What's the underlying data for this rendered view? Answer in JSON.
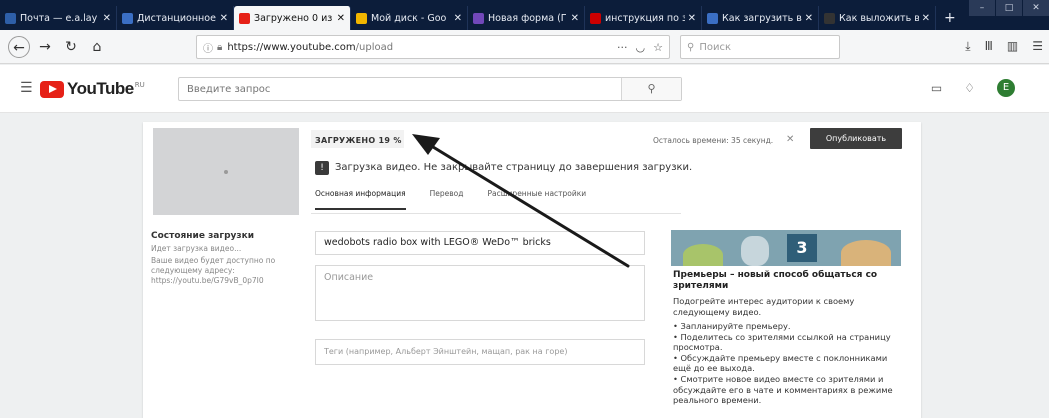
{
  "browser": {
    "tabs": [
      {
        "label": "Почта — e.a.lay",
        "icon": "mail-icon",
        "color": "#2e5fa8"
      },
      {
        "label": "Дистанционное",
        "icon": "page-icon",
        "color": "#3b6fc4"
      },
      {
        "label": "Загружено 0 из",
        "icon": "youtube-icon",
        "color": "#e62117",
        "active": true
      },
      {
        "label": "Мой диск - Goo",
        "icon": "drive-icon",
        "color": "#f2b600"
      },
      {
        "label": "Новая форма (Г",
        "icon": "forms-icon",
        "color": "#7248b9"
      },
      {
        "label": "инструкция по з",
        "icon": "yandex-icon",
        "color": "#cc0000"
      },
      {
        "label": "Как загрузить в",
        "icon": "page-icon",
        "color": "#3b6fc4"
      },
      {
        "label": "Как выложить в",
        "icon": "page-icon",
        "color": "#333333"
      }
    ],
    "new_tab": "+",
    "url_host": "https://www.youtube.com",
    "url_path": "/upload",
    "url_more": "···",
    "search_placeholder": "Поиск"
  },
  "youtube": {
    "search_placeholder": "Введите запрос",
    "logo_text": "YouTube",
    "logo_region": "RU",
    "avatar_letter": "E"
  },
  "upload": {
    "progress_label": "ЗАГРУЖЕНО 19 %",
    "progress_percent": 19,
    "remaining_text": "Осталось времени: 35 секунд.",
    "publish_label": "Опубликовать",
    "warning_text": "Загрузка видео. Не закрывайте страницу до завершения загрузки.",
    "tabs": [
      "Основная информация",
      "Перевод",
      "Расширенные настройки"
    ],
    "status_heading": "Состояние загрузки",
    "status_sub": "Идет загрузка видео...",
    "status_link": "Ваше видео будет доступно по следующему адресу: https://youtu.be/G79vB_0p7I0",
    "title_value": "wedobots radio box with LEGO® WeDo™ bricks",
    "description_placeholder": "Описание",
    "tags_placeholder": "Теги (например, Альберт Эйнштейн, мащап, рак на горе)"
  },
  "promo": {
    "banner_number": "3",
    "title": "Премьеры – новый способ общаться со зрителями",
    "text": "Подогрейте интерес аудитории к своему следующему видео.",
    "bullets": [
      "• Запланируйте премьеру.",
      "• Поделитесь со зрителями ссылкой на страницу просмотра.",
      "• Обсуждайте премьеру вместе с поклонниками ещё до ее выхода.",
      "• Смотрите новое видео вместе со зрителями и обсуждайте его в чате и комментариях в режиме реального времени."
    ]
  }
}
